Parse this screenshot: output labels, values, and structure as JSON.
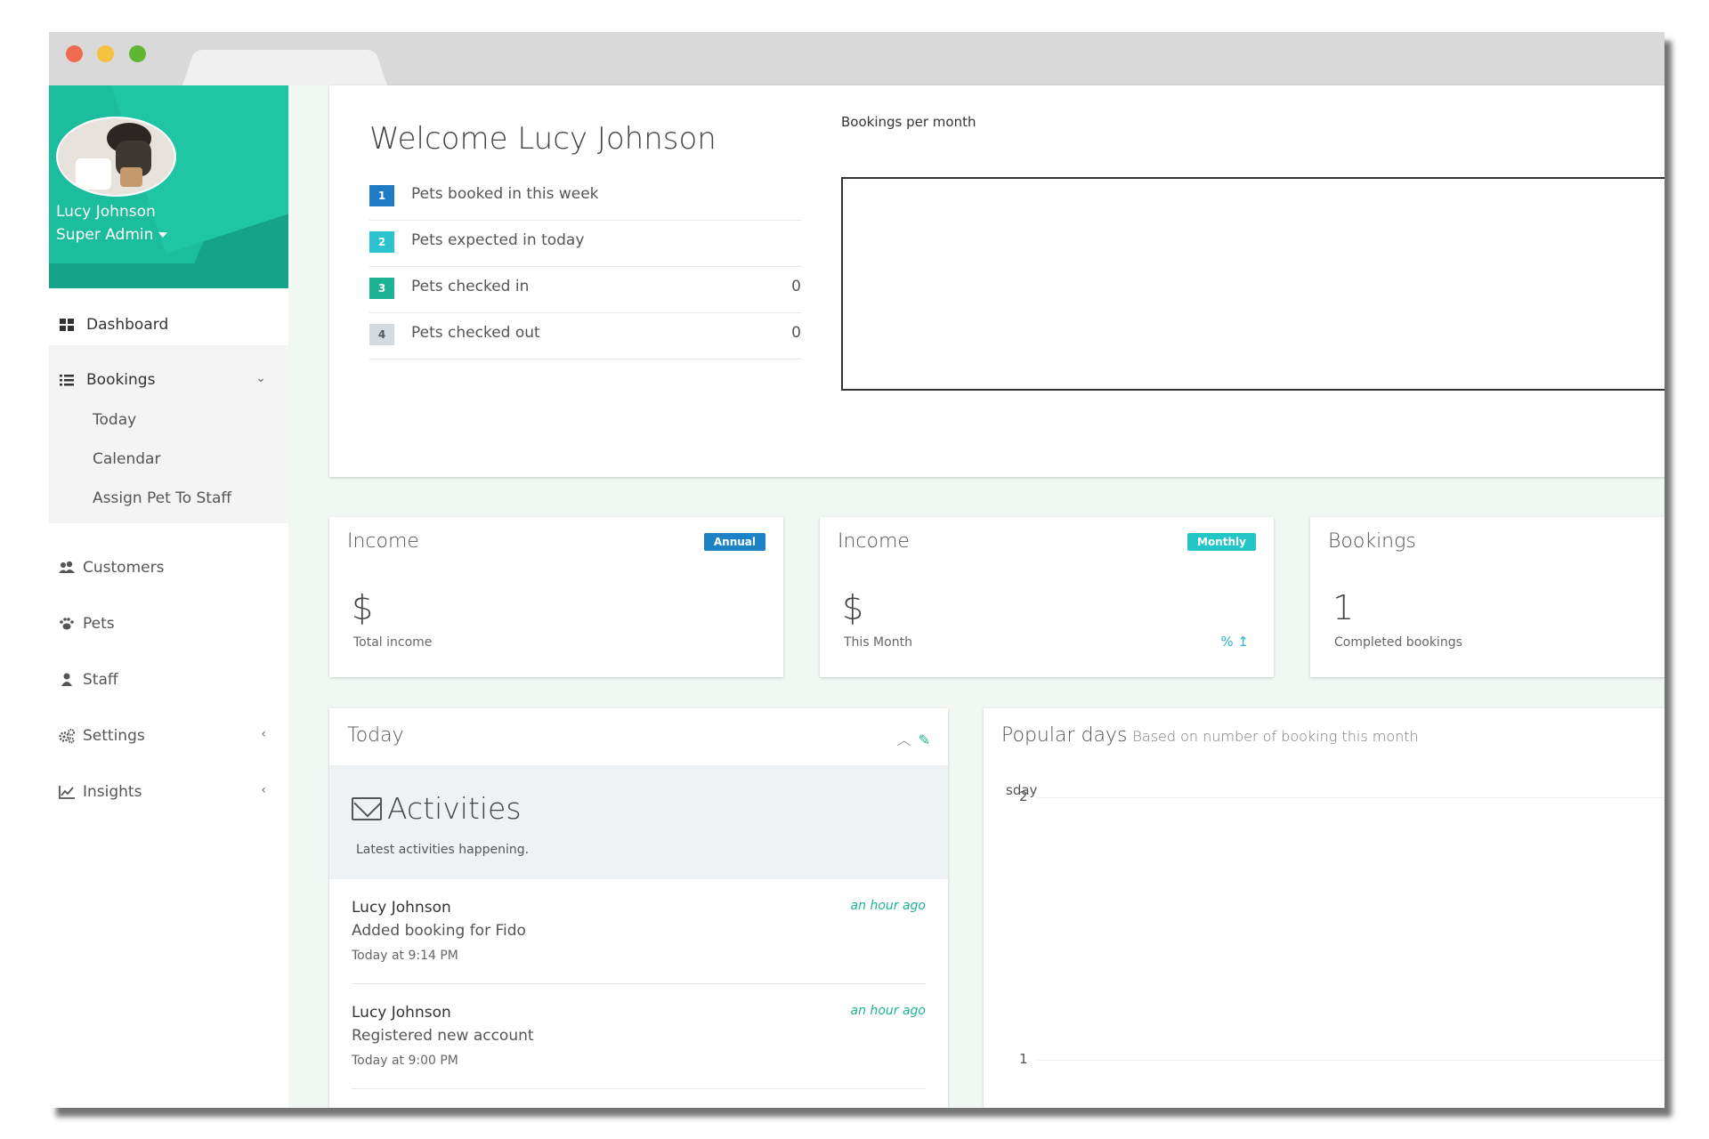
{
  "profile": {
    "name": "Lucy Johnson",
    "role": "Super Admin"
  },
  "sidebar": {
    "dashboard": "Dashboard",
    "bookings": "Bookings",
    "bookings_sub": [
      "Today",
      "Calendar",
      "Assign Pet To Staff"
    ],
    "customers": "Customers",
    "pets": "Pets",
    "staff": "Staff",
    "settings": "Settings",
    "insights": "Insights"
  },
  "welcome": {
    "title": "Welcome Lucy Johnson",
    "stats": [
      {
        "badge": "1",
        "label": "Pets booked in this week",
        "value": "",
        "color": "#1f7bc4"
      },
      {
        "badge": "2",
        "label": "Pets expected in today",
        "value": "",
        "color": "#2bc3d0"
      },
      {
        "badge": "3",
        "label": "Pets checked in",
        "value": "0",
        "color": "#1bb394"
      },
      {
        "badge": "4",
        "label": "Pets checked out",
        "value": "0",
        "color": "#d3dbe0"
      }
    ],
    "chart_title": "Bookings per month"
  },
  "cards": {
    "annual": {
      "title": "Income",
      "badge": "Annual",
      "badge_color": "#1c84c6",
      "value": "$",
      "sub": "Total income"
    },
    "monthly": {
      "title": "Income",
      "badge": "Monthly",
      "badge_color": "#23c6c8",
      "value": "$",
      "sub": "This Month",
      "pct": "% ↥"
    },
    "bookings": {
      "title": "Bookings",
      "value": "1",
      "sub": "Completed bookings"
    }
  },
  "today": {
    "title": "Today",
    "activities_title": "Activities",
    "activities_sub": "Latest activities happening.",
    "items": [
      {
        "name": "Lucy Johnson",
        "desc": "Added booking for Fido",
        "time": "Today at 9:14 PM",
        "ago": "an hour ago"
      },
      {
        "name": "Lucy Johnson",
        "desc": "Registered new account",
        "time": "Today at 9:00 PM",
        "ago": "an hour ago"
      }
    ]
  },
  "popular": {
    "title": "Popular days",
    "subtitle": "Based on number of booking this month",
    "tick_day": "sday",
    "tick_2": "2",
    "tick_1": "1"
  },
  "colors": {
    "accent": "#1bb394",
    "sidebar_header": "#15a48a"
  }
}
